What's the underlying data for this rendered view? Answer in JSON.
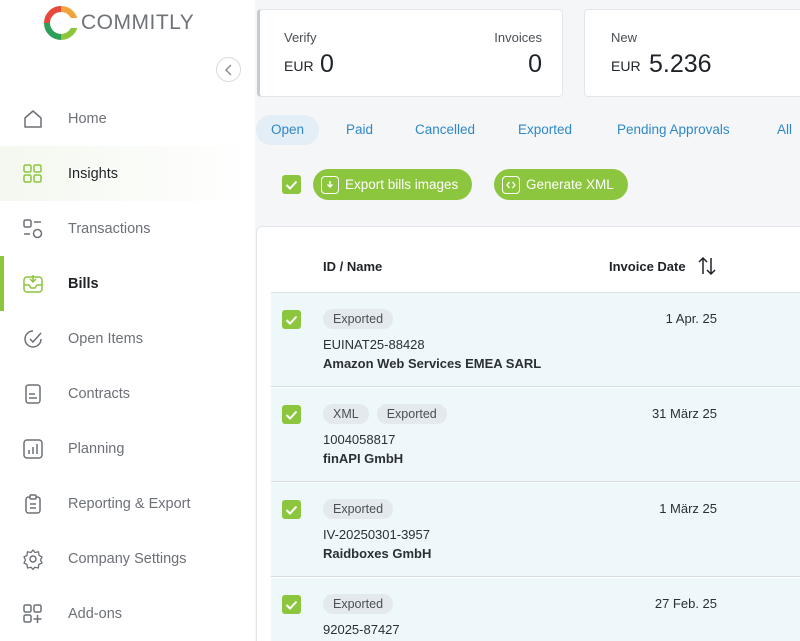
{
  "app": {
    "name": "COMMITLY"
  },
  "sidebar": {
    "items": [
      {
        "label": "Home",
        "icon": "home-icon"
      },
      {
        "label": "Insights",
        "icon": "grid-icon"
      },
      {
        "label": "Transactions",
        "icon": "transactions-icon"
      },
      {
        "label": "Bills",
        "icon": "inbox-icon"
      },
      {
        "label": "Open Items",
        "icon": "open-items-icon"
      },
      {
        "label": "Contracts",
        "icon": "document-icon"
      },
      {
        "label": "Planning",
        "icon": "chart-icon"
      },
      {
        "label": "Reporting & Export",
        "icon": "clipboard-icon"
      },
      {
        "label": "Company Settings",
        "icon": "gear-icon"
      },
      {
        "label": "Add-ons",
        "icon": "add-ons-icon"
      }
    ],
    "active": "Bills",
    "highlighted": "Insights"
  },
  "summary": {
    "verify": {
      "label": "Verify",
      "currency": "EUR",
      "amount": "0",
      "invoices_label": "Invoices",
      "invoices_count": "0"
    },
    "new": {
      "label": "New",
      "currency": "EUR",
      "amount": "5.236"
    }
  },
  "tabs": [
    {
      "label": "Open",
      "active": true
    },
    {
      "label": "Paid"
    },
    {
      "label": "Cancelled"
    },
    {
      "label": "Exported"
    },
    {
      "label": "Pending Approvals"
    },
    {
      "label": "All"
    }
  ],
  "actions": {
    "export_images": "Export bills images",
    "generate_xml": "Generate XML"
  },
  "table": {
    "columns": {
      "id_name": "ID / Name",
      "invoice_date": "Invoice Date"
    },
    "rows": [
      {
        "badges": [
          "Exported"
        ],
        "id": "EUINAT25-88428",
        "name": "Amazon Web Services EMEA SARL",
        "date": "1 Apr. 25"
      },
      {
        "badges": [
          "XML",
          "Exported"
        ],
        "id": "1004058817",
        "name": "finAPI GmbH",
        "date": "31 März 25"
      },
      {
        "badges": [
          "Exported"
        ],
        "id": "IV-20250301-3957",
        "name": "Raidboxes GmbH",
        "date": "1 März 25"
      },
      {
        "badges": [
          "Exported"
        ],
        "id": "92025-87427",
        "name": "",
        "date": "27 Feb. 25"
      }
    ]
  },
  "colors": {
    "accent": "#8cc63f",
    "link": "#2f88c8",
    "row_bg": "#eef7f9"
  }
}
